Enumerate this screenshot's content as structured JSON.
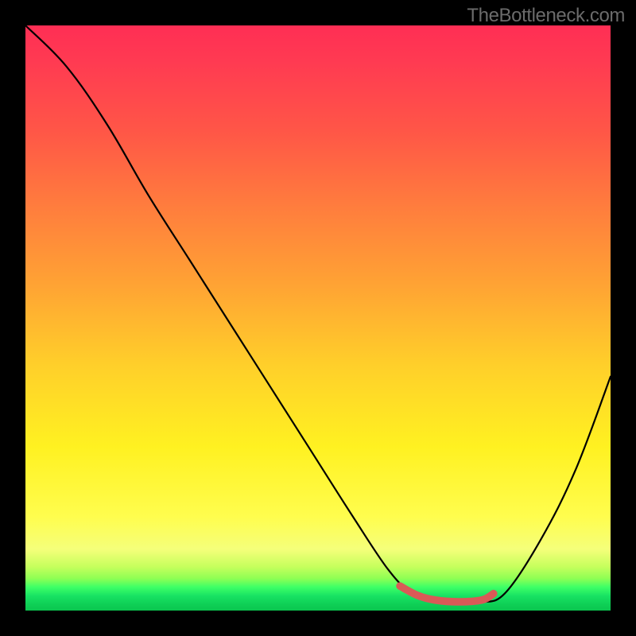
{
  "watermark": "TheBottleneck.com",
  "chart_data": {
    "type": "line",
    "title": "",
    "xlabel": "",
    "ylabel": "",
    "xlim": [
      0,
      100
    ],
    "ylim": [
      0,
      100
    ],
    "series": [
      {
        "name": "bottleneck-curve",
        "x": [
          0,
          7,
          14,
          21,
          28,
          35,
          42,
          49,
          56,
          62,
          66,
          70,
          74,
          78,
          82,
          88,
          94,
          100
        ],
        "values": [
          100,
          93,
          83,
          71,
          60,
          49,
          38,
          27,
          16,
          7,
          3,
          1.5,
          1.2,
          1.4,
          3,
          12,
          24,
          40
        ]
      },
      {
        "name": "optimal-range-marker",
        "x": [
          64,
          67,
          70,
          74,
          78,
          80
        ],
        "values": [
          4.2,
          2.6,
          1.8,
          1.5,
          1.8,
          2.9
        ]
      }
    ],
    "colors": {
      "curve": "#000000",
      "marker": "#d95a57",
      "gradient_top": "#ff2e54",
      "gradient_mid": "#fff121",
      "gradient_bottom": "#0bc64f"
    }
  }
}
